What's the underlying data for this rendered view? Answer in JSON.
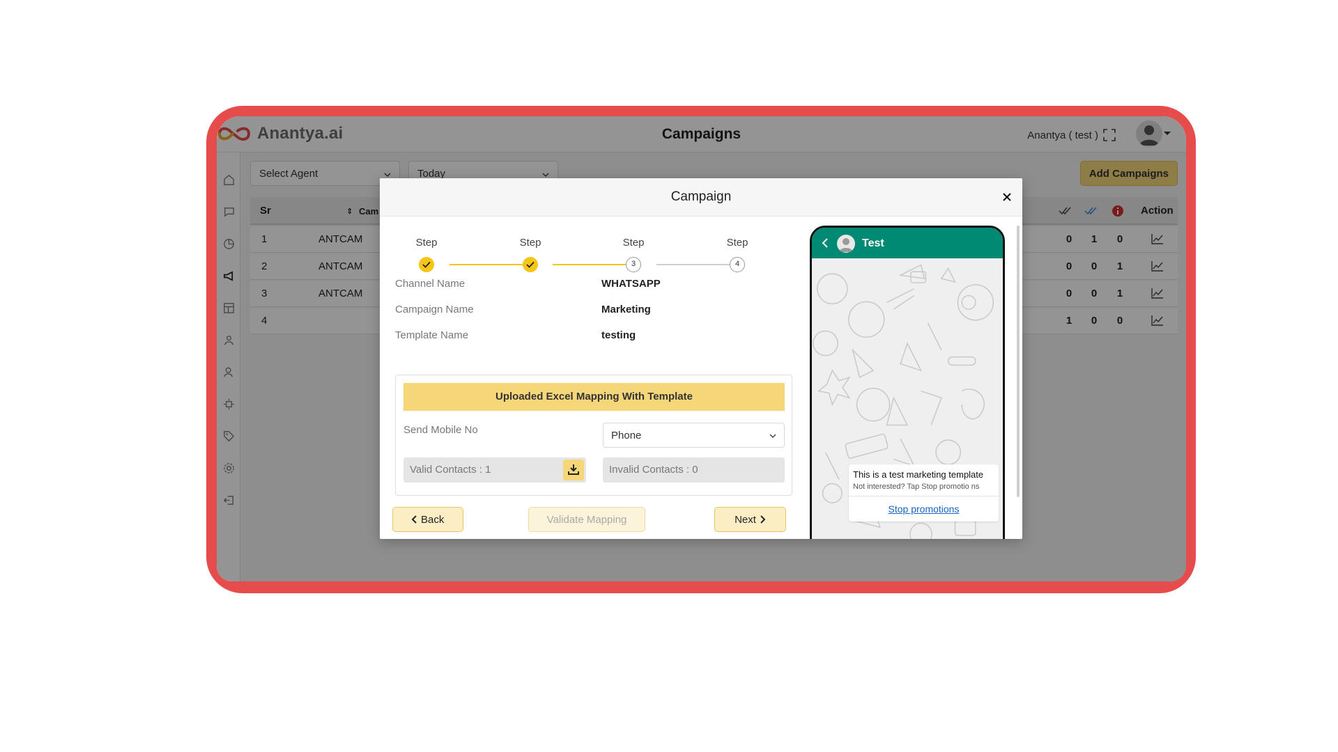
{
  "app": {
    "brand": "Anantya.ai",
    "page_title": "Campaigns",
    "user_label": "Anantya ( test )"
  },
  "filters": {
    "agent": "Select Agent",
    "date": "Today"
  },
  "add_button": "Add Campaigns",
  "table": {
    "headers": {
      "sr": "Sr",
      "campaign": "Cam",
      "action": "Action"
    },
    "rows": [
      {
        "sr": "1",
        "campaign": "ANTCAM",
        "sent": "0",
        "read": "1",
        "failed": "0"
      },
      {
        "sr": "2",
        "campaign": "ANTCAM",
        "sent": "0",
        "read": "0",
        "failed": "1"
      },
      {
        "sr": "3",
        "campaign": "ANTCAM",
        "sent": "0",
        "read": "0",
        "failed": "1"
      },
      {
        "sr": "4",
        "campaign": "",
        "sent": "1",
        "read": "0",
        "failed": "0"
      }
    ]
  },
  "modal": {
    "title": "Campaign",
    "steps": [
      {
        "label": "Step",
        "number": "1",
        "done": true
      },
      {
        "label": "Step",
        "number": "2",
        "done": true
      },
      {
        "label": "Step",
        "number": "3",
        "done": false
      },
      {
        "label": "Step",
        "number": "4",
        "done": false
      }
    ],
    "info": [
      {
        "label": "Channel Name",
        "value": "WHATSAPP"
      },
      {
        "label": "Campaign Name",
        "value": "Marketing"
      },
      {
        "label": "Template Name",
        "value": "testing"
      }
    ],
    "mapping": {
      "banner": "Uploaded Excel Mapping With Template",
      "send_label": "Send Mobile No",
      "phone_select": "Phone",
      "valid_contacts": "Valid Contacts : 1",
      "invalid_contacts": "Invalid Contacts : 0"
    },
    "buttons": {
      "back": "Back",
      "validate": "Validate Mapping",
      "next": "Next"
    },
    "preview": {
      "contact_name": "Test",
      "message": "This is a test marketing template",
      "footer": "Not interested? Tap Stop promotio ns",
      "link": "Stop promotions"
    }
  },
  "colors": {
    "frame": "#e74c4c",
    "accent_yellow": "#f5c518",
    "whatsapp_green": "#008a73",
    "failed_red": "#d32f2f",
    "read_blue": "#2e8be0"
  }
}
